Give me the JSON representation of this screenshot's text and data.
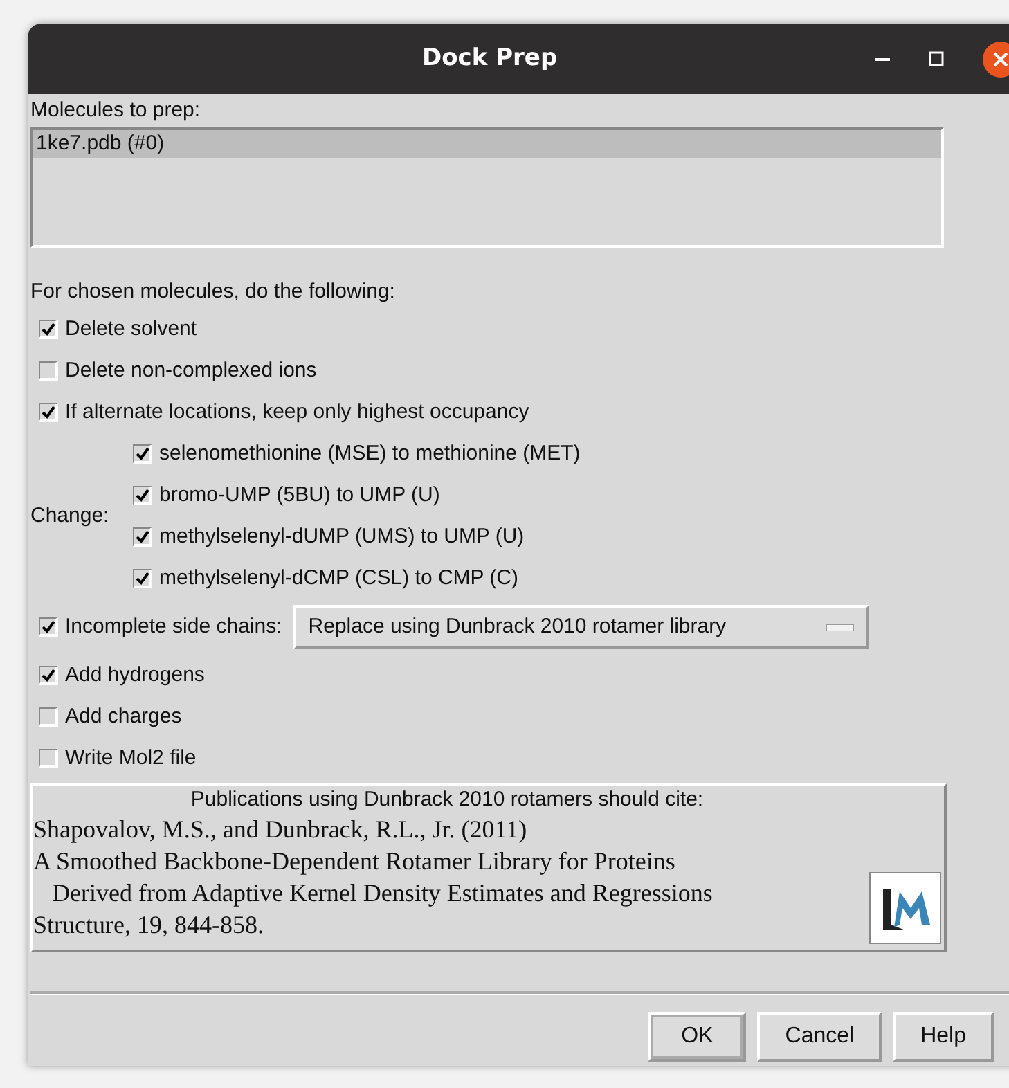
{
  "window": {
    "title": "Dock Prep"
  },
  "molecules": {
    "label": "Molecules to prep:",
    "items": [
      {
        "text": "1ke7.pdb (#0)",
        "selected": true
      }
    ]
  },
  "heading": "For chosen molecules, do the following:",
  "options": [
    {
      "kind": "checkbox",
      "label": "Delete solvent",
      "checked": true
    },
    {
      "kind": "checkbox",
      "label": "Delete non-complexed ions",
      "checked": false
    },
    {
      "kind": "checkbox",
      "label": "If alternate locations, keep only highest occupancy",
      "checked": true
    },
    {
      "kind": "change",
      "label": "Change:",
      "items": [
        {
          "label": "selenomethionine (MSE) to methionine (MET)",
          "checked": true
        },
        {
          "label": "bromo-UMP (5BU) to UMP (U)",
          "checked": true
        },
        {
          "label": "methylselenyl-dUMP (UMS) to UMP (U)",
          "checked": true
        },
        {
          "label": "methylselenyl-dCMP (CSL) to CMP (C)",
          "checked": true
        }
      ]
    },
    {
      "kind": "dropdown",
      "label": "Incomplete side chains:",
      "checked": true,
      "value": "Replace using Dunbrack 2010 rotamer library"
    },
    {
      "kind": "checkbox",
      "label": "Add hydrogens",
      "checked": true
    },
    {
      "kind": "checkbox",
      "label": "Add charges",
      "checked": false
    },
    {
      "kind": "checkbox",
      "label": "Write Mol2 file",
      "checked": false
    }
  ],
  "citation": {
    "heading": "Publications using Dunbrack 2010 rotamers should cite:",
    "lines": [
      "Shapovalov, M.S., and Dunbrack, R.L., Jr. (2011)",
      "A Smoothed Backbone-Dependent Rotamer Library for Proteins",
      "   Derived from Adaptive Kernel Density Estimates and Regressions",
      "Structure, 19, 844-858."
    ]
  },
  "buttons": [
    {
      "label": "OK",
      "default": true
    },
    {
      "label": "Cancel",
      "default": false
    },
    {
      "label": "Help",
      "default": false
    }
  ]
}
